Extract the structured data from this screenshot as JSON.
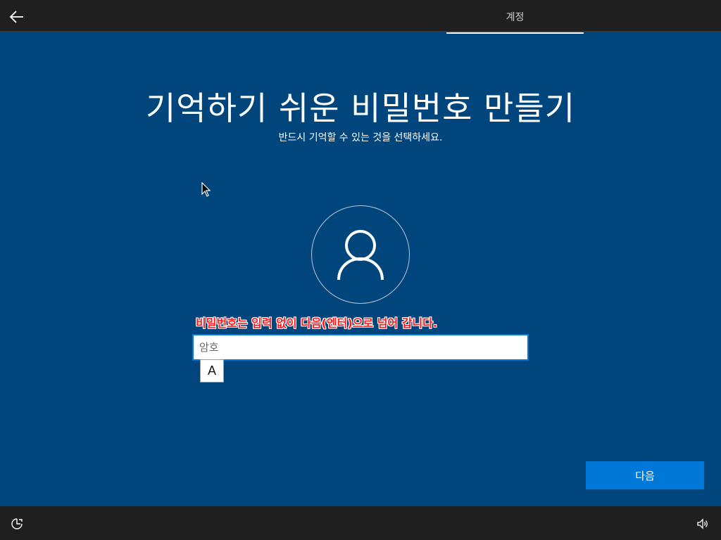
{
  "header": {
    "back_icon": "back-arrow-icon",
    "tab_label": "계정"
  },
  "main": {
    "title": "기억하기 쉬운 비밀번호 만들기",
    "subtitle": "반드시 기억할 수 있는 것을 선택하세요.",
    "avatar_icon": "user-icon",
    "annotation": "비밀번호는 입력 없이 다음(엔터)으로 넘어 갑니다.",
    "password": {
      "value": "",
      "placeholder": "암호"
    },
    "ime_indicator": "A",
    "next_label": "다음"
  },
  "footer": {
    "ease_icon": "ease-of-access-icon",
    "volume_icon": "volume-icon"
  },
  "colors": {
    "background": "#00457c",
    "bar": "#1f1f1f",
    "accent": "#0078d7",
    "annotation": "#ff1b1b"
  }
}
